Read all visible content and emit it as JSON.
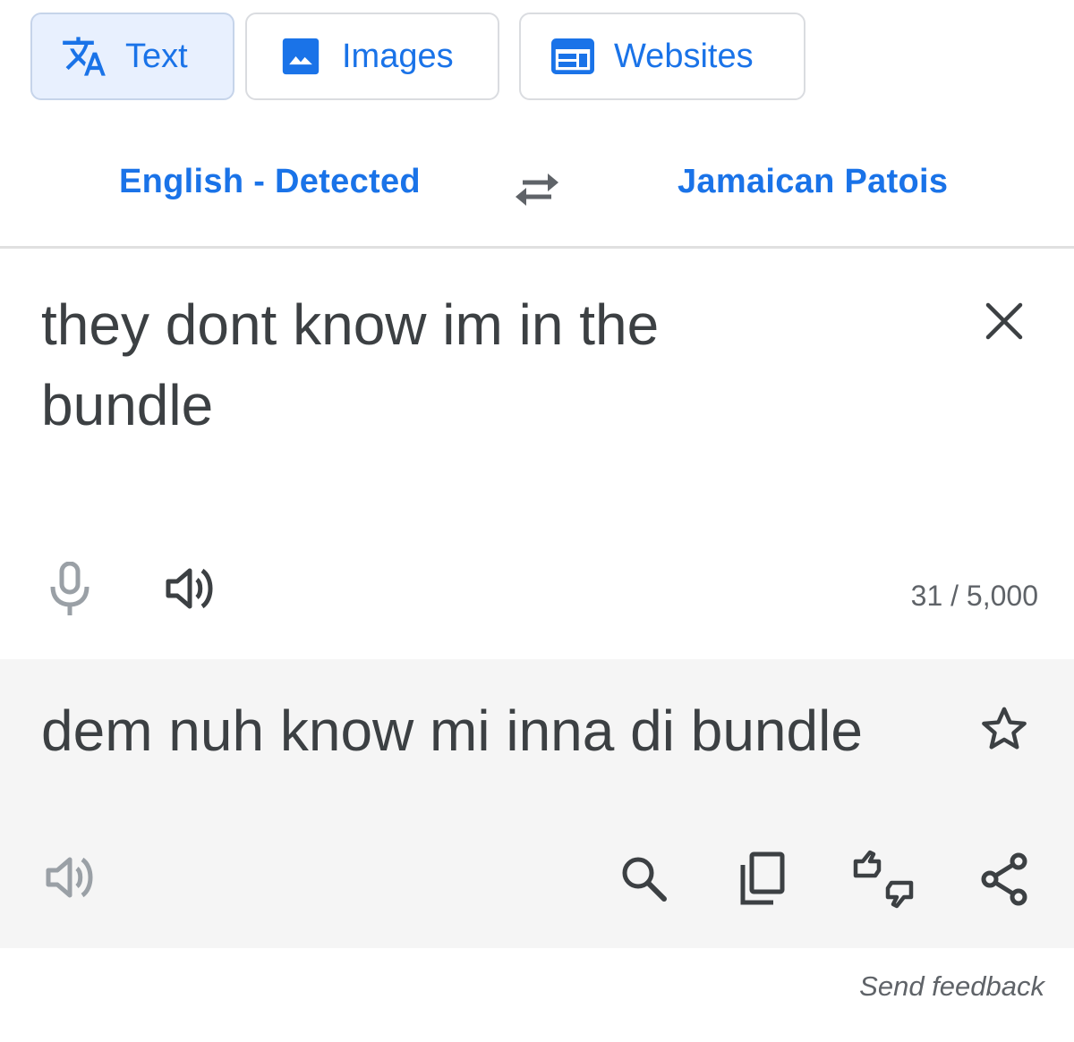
{
  "tabs": [
    {
      "label": "Text",
      "icon": "translate-icon",
      "active": true
    },
    {
      "label": "Images",
      "icon": "image-icon",
      "active": false
    },
    {
      "label": "Websites",
      "icon": "web-icon",
      "active": false
    }
  ],
  "languages": {
    "source": "English - Detected",
    "target": "Jamaican Patois"
  },
  "source": {
    "text": "they dont know im in the bundle",
    "char_count": "31 / 5,000"
  },
  "translation": {
    "text": "dem nuh know mi inna di bundle"
  },
  "footer": {
    "send_feedback": "Send feedback"
  },
  "colors": {
    "accent": "#1a73e8",
    "text": "#3c4043",
    "icon": "#5f6368",
    "icon_disabled": "#9aa0a6",
    "active_tab_bg": "#e8f0fe",
    "translation_bg": "#f5f5f5"
  }
}
